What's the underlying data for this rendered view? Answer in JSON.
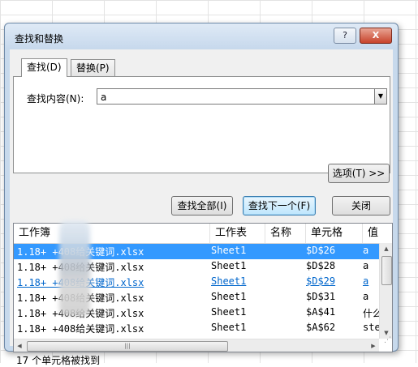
{
  "dialog": {
    "title": "查找和替换",
    "help_button": "?",
    "close_button": "X"
  },
  "tabs": {
    "find": "查找(D)",
    "replace": "替换(P)"
  },
  "find_what": {
    "label": "查找内容(N):",
    "value": "a"
  },
  "buttons": {
    "options": "选项(T) >>",
    "find_all": "查找全部(I)",
    "find_next": "查找下一个(F)",
    "close": "关闭"
  },
  "results": {
    "columns": [
      "工作簿",
      "工作表",
      "名称",
      "单元格",
      "值"
    ],
    "rows": [
      {
        "workbook": "1.18+    +408给关键词.xlsx",
        "sheet": "Sheet1",
        "name": "",
        "cell": "$D$26",
        "value": "a",
        "state": "selected"
      },
      {
        "workbook": "1.18+    +408给关键词.xlsx",
        "sheet": "Sheet1",
        "name": "",
        "cell": "$D$28",
        "value": "a",
        "state": "normal"
      },
      {
        "workbook": "1.18+    +408给关键词.xlsx",
        "sheet": "Sheet1",
        "name": "",
        "cell": "$D$29",
        "value": "a",
        "state": "visited"
      },
      {
        "workbook": "1.18+    +408给关键词.xlsx",
        "sheet": "Sheet1",
        "name": "",
        "cell": "$D$31",
        "value": "a",
        "state": "normal"
      },
      {
        "workbook": "1.18+    +408给关键词.xlsx",
        "sheet": "Sheet1",
        "name": "",
        "cell": "$A$41",
        "value": "什么",
        "state": "normal"
      },
      {
        "workbook": "1.18+    +408给关键词.xlsx",
        "sheet": "Sheet1",
        "name": "",
        "cell": "$A$62",
        "value": "ste",
        "state": "normal"
      }
    ]
  },
  "status": "17 个单元格被找到"
}
